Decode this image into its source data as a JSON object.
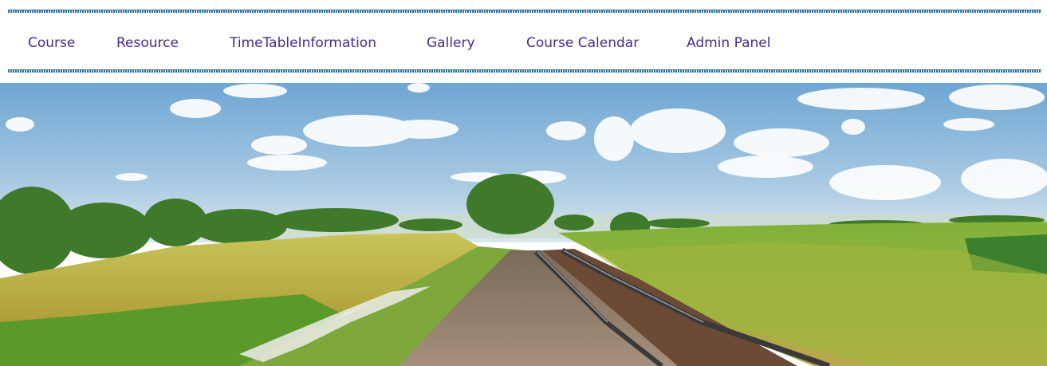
{
  "nav": {
    "items": [
      {
        "label": "Course"
      },
      {
        "label": "Resource"
      },
      {
        "label": "TimeTableInformation"
      },
      {
        "label": "Gallery"
      },
      {
        "label": "Course Calendar"
      },
      {
        "label": "Admin Panel"
      }
    ],
    "text_color": "#4b2a86",
    "border_color": "#2a6f9a"
  },
  "hero": {
    "image": "landscape-railway-photo",
    "sky_color": "#7fb1d8",
    "field_color": "#b7b445",
    "grass_color": "#6aa62b"
  }
}
